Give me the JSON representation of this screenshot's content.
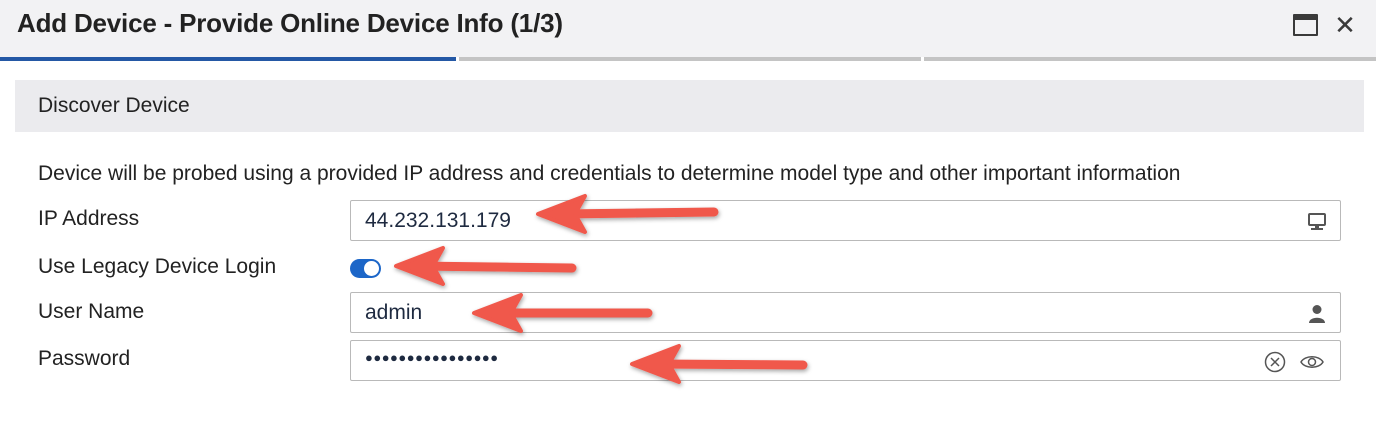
{
  "dialog": {
    "title": "Add Device - Provide Online Device Info (1/3)",
    "steps": [
      {
        "state": "active"
      },
      {
        "state": "inactive"
      },
      {
        "state": "inactive"
      }
    ],
    "accent_color": "#2458a5"
  },
  "section": {
    "title": "Discover Device",
    "description": "Device will be probed using a provided IP address and credentials to determine model type and other important information"
  },
  "form": {
    "ip_address": {
      "label": "IP Address",
      "value": "44.232.131.179",
      "icon": "computer-icon"
    },
    "legacy_login": {
      "label": "Use Legacy Device Login",
      "enabled": true,
      "toggle_color": "#1c66c8"
    },
    "user_name": {
      "label": "User Name",
      "value": "admin",
      "icon": "user-icon"
    },
    "password": {
      "label": "Password",
      "masked_value": "●●●●●●●●●●●●●●●●",
      "icons": [
        "clear-icon",
        "show-password-icon"
      ]
    }
  },
  "annotations": {
    "arrow_color": "#f0584c"
  }
}
